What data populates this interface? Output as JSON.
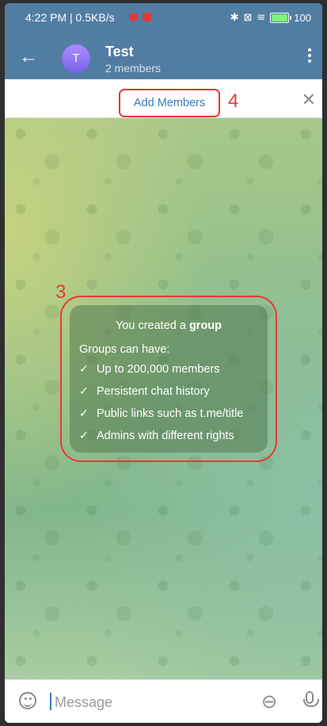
{
  "status_bar": {
    "time": "4:22 PM | 0.5KB/s",
    "battery": "100"
  },
  "header": {
    "back_icon": "arrow-left-icon",
    "avatar_letter": "T",
    "title": "Test",
    "subtitle": "2 members",
    "menu_icon": "more-vertical-icon"
  },
  "add_members": {
    "label": "Add Members",
    "annotation": "4",
    "close_icon": "close-icon"
  },
  "info_card": {
    "annotation": "3",
    "head_prefix": "You created a ",
    "head_bold": "group",
    "lead": "Groups can have:",
    "items": [
      "Up to 200,000 members",
      "Persistent chat history",
      "Public links such as t.me/title",
      "Admins with different rights"
    ]
  },
  "composer": {
    "placeholder": "Message",
    "emoji_icon": "emoji-icon",
    "attach_icon": "paperclip-icon",
    "mic_icon": "microphone-icon"
  },
  "colors": {
    "header": "#527da3",
    "annotation": "#e53935",
    "link": "#3a7ab8"
  }
}
